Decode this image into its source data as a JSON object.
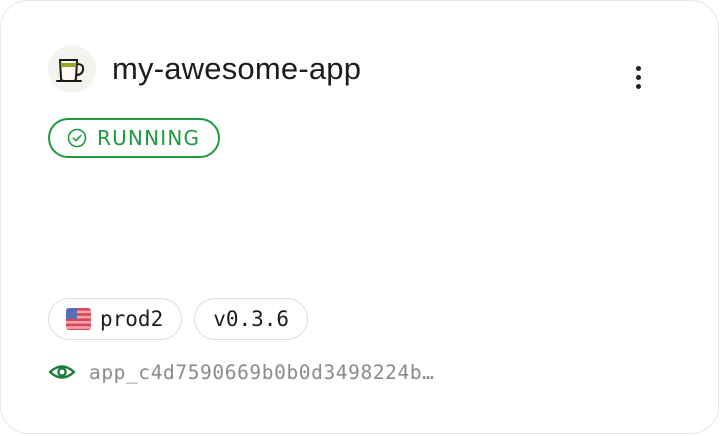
{
  "app": {
    "name": "my-awesome-app",
    "logo_icon": "coffee-mug-icon"
  },
  "menu": {
    "icon": "vertical-ellipsis-icon"
  },
  "status": {
    "label": "RUNNING",
    "icon": "check-circle-icon",
    "color": "#1e9a3e"
  },
  "tags": {
    "environment": {
      "label": "prod2",
      "icon": "us-flag-icon"
    },
    "version": {
      "label": "v0.3.6"
    }
  },
  "app_id": {
    "value": "app_c4d7590669b0b0d3498224b…",
    "icon": "eye-icon"
  }
}
